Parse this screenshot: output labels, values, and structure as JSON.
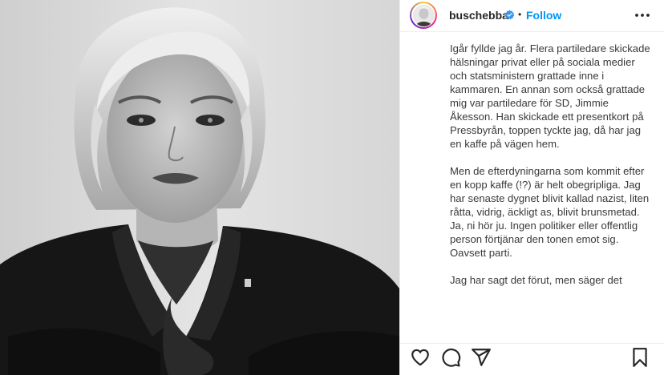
{
  "post": {
    "username": "buschebba",
    "verified": true,
    "separator": "•",
    "follow_label": "Follow",
    "caption_paragraphs": [
      "Igår fyllde jag år. Flera partiledare skickade hälsningar privat eller på sociala medier och statsministern grattade inne i kammaren. En annan som också grattade mig var partiledare för SD, Jimmie Åkesson. Han skickade ett presentkort på Pressbyrån, toppen tyckte jag, då har jag en kaffe på vägen hem.",
      "Men de efterdyningarna som kommit efter en kopp kaffe (!?) är helt obegripliga. Jag har senaste dygnet blivit kallad nazist, liten råtta, vidrig, äckligt as, blivit brunsmetad. Ja, ni hör ju. Ingen politiker eller offentlig person förtjänar den tonen emot sig. Oavsett parti.",
      "Jag har sagt det förut, men säger det"
    ]
  },
  "icons": {
    "verified": "verified-badge-icon",
    "more": "more-options-icon",
    "like": "heart-icon",
    "comment": "comment-icon",
    "share": "share-icon",
    "save": "bookmark-icon"
  },
  "colors": {
    "accent": "#0095f6",
    "text": "#262626",
    "border": "#efefef"
  }
}
